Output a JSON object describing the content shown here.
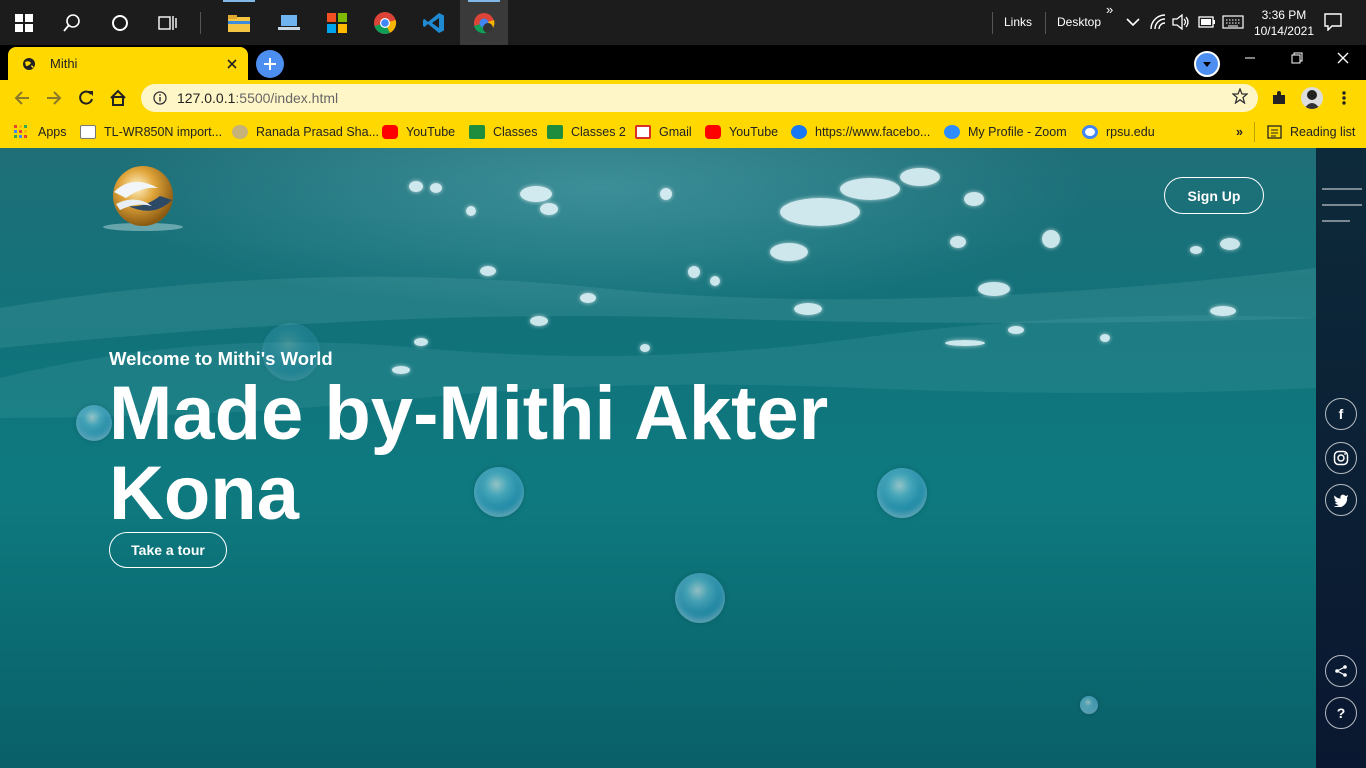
{
  "taskbar": {
    "links_label": "Links",
    "desktop_label": "Desktop",
    "time": "3:36 PM",
    "date": "10/14/2021",
    "overflow_glyph": "»"
  },
  "browser": {
    "tab_title": "Mithi",
    "url_host": "127.0.0.1",
    "url_rest": ":5500/index.html",
    "accent_color": "#ffd800"
  },
  "bookmarks": [
    {
      "label": "Apps",
      "icon": "apps-grid-icon",
      "color": "#e04b3f"
    },
    {
      "label": "TL-WR850N import...",
      "icon": "router-icon",
      "color": "#666666"
    },
    {
      "label": "Ranada Prasad Sha...",
      "icon": "rpsu-logo-icon",
      "color": "#8a6d3b"
    },
    {
      "label": "YouTube",
      "icon": "youtube-icon",
      "color": "#ff0000"
    },
    {
      "label": "Classes",
      "icon": "google-classroom-icon",
      "color": "#1e8e3e"
    },
    {
      "label": "Classes 2",
      "icon": "google-classroom-icon",
      "color": "#1e8e3e"
    },
    {
      "label": "Gmail",
      "icon": "gmail-icon",
      "color": "#d93025"
    },
    {
      "label": "YouTube",
      "icon": "youtube-icon",
      "color": "#ff0000"
    },
    {
      "label": "https://www.facebo...",
      "icon": "facebook-icon",
      "color": "#1877f2"
    },
    {
      "label": "My Profile - Zoom",
      "icon": "zoom-icon",
      "color": "#2d8cff"
    },
    {
      "label": "rpsu.edu",
      "icon": "google-icon",
      "color": "#4285f4"
    }
  ],
  "reading_list_label": "Reading list",
  "hero": {
    "signup_label": "Sign Up",
    "welcome": "Welcome to Mithi's World",
    "headline": "Made by-Mithi Akter Kona",
    "tour_label": "Take a tour"
  },
  "social": {
    "facebook": "f",
    "share": "<",
    "help": "?"
  }
}
